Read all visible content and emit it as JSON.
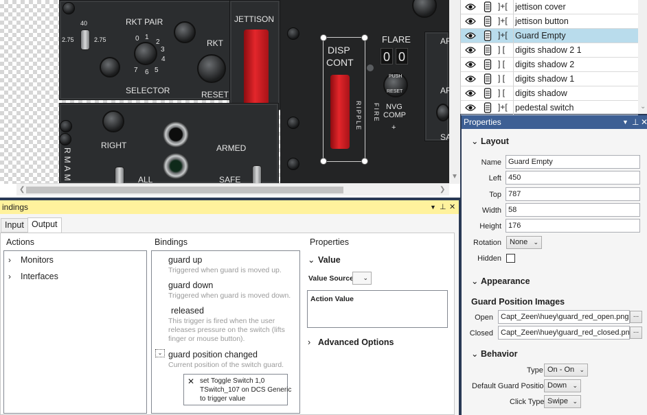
{
  "cockpit": {
    "rkt_pair": "RKT PAIR",
    "selector": "SELECTOR",
    "rkt": "RKT",
    "reset": "RESET",
    "jettison": "JETTISON",
    "disp": "DISP",
    "cont": "CONT",
    "flare": "FLARE",
    "digit_1": "0",
    "digit_2": "0",
    "push": "PUSH",
    "reset_small": "RESET",
    "nvg": "NVG",
    "comp": "COMP",
    "plus": "+",
    "ripple": "RIPPLE",
    "fire": "FIRE",
    "sw_40": "40",
    "sw_275a": "2.75",
    "sw_275b": "2.75",
    "dial_0": "0",
    "dial_1": "1",
    "dial_2": "2",
    "dial_3": "3",
    "dial_4": "4",
    "dial_5": "5",
    "dial_6": "6",
    "dial_7": "7",
    "right": "RIGHT",
    "all": "ALL",
    "armed": "ARMED",
    "safe": "SAFE",
    "armam": "ARMAM",
    "ar1": "AF",
    "ar2": "AF",
    "sa": "SA"
  },
  "layers": [
    {
      "name": "jettison cover",
      "link": "]+["
    },
    {
      "name": "jettison button",
      "link": "]+["
    },
    {
      "name": "Guard Empty",
      "link": "]+[",
      "selected": true
    },
    {
      "name": "digits shadow 2 1",
      "link": "] ["
    },
    {
      "name": "digits shadow 2",
      "link": "] ["
    },
    {
      "name": "digits shadow 1",
      "link": "] ["
    },
    {
      "name": "digits shadow",
      "link": "] ["
    },
    {
      "name": "pedestal switch",
      "link": "]+["
    }
  ],
  "props": {
    "title": "Properties",
    "layout_section": "Layout",
    "name_label": "Name",
    "name_value": "Guard Empty",
    "left_label": "Left",
    "left_value": "450",
    "top_label": "Top",
    "top_value": "787",
    "width_label": "Width",
    "width_value": "58",
    "height_label": "Height",
    "height_value": "176",
    "rotation_label": "Rotation",
    "rotation_value": "None",
    "hidden_label": "Hidden",
    "appearance_section": "Appearance",
    "guard_images_title": "Guard Position Images",
    "open_label": "Open",
    "open_value": "Capt_Zeen\\huey\\guard_red_open.png",
    "closed_label": "Closed",
    "closed_value": "Capt_Zeen\\huey\\guard_red_closed.png",
    "browse": "...",
    "behavior_section": "Behavior",
    "type_label": "Type",
    "type_value": "On - On",
    "default_guard_label": "Default Guard Position",
    "default_guard_value": "Down",
    "click_type_label": "Click Type",
    "click_type_value": "Swipe"
  },
  "bindings": {
    "title": "indings",
    "tab_input": "Input",
    "tab_output": "Output",
    "actions_header": "Actions",
    "bindings_header": "Bindings",
    "properties_header": "Properties",
    "tree": [
      {
        "label": "Monitors"
      },
      {
        "label": "Interfaces"
      }
    ],
    "triggers": [
      {
        "name": "guard up",
        "desc": "Triggered when guard is moved up."
      },
      {
        "name": "guard down",
        "desc": "Triggered when guard is moved down."
      },
      {
        "name": "released",
        "desc": "This trigger is fired when the user releases pressure on the switch (lifts finger or mouse button)."
      },
      {
        "name": "guard position changed",
        "desc": "Current position of the switch guard."
      }
    ],
    "action_line1": "set Toggle Switch 1,0",
    "action_line2": "TSwitch_107 on DCS Generic",
    "action_line3": "to  trigger value",
    "value_section": "Value",
    "value_source_label": "Value Source",
    "action_value_label": "Action Value",
    "advanced_options": "Advanced Options"
  }
}
